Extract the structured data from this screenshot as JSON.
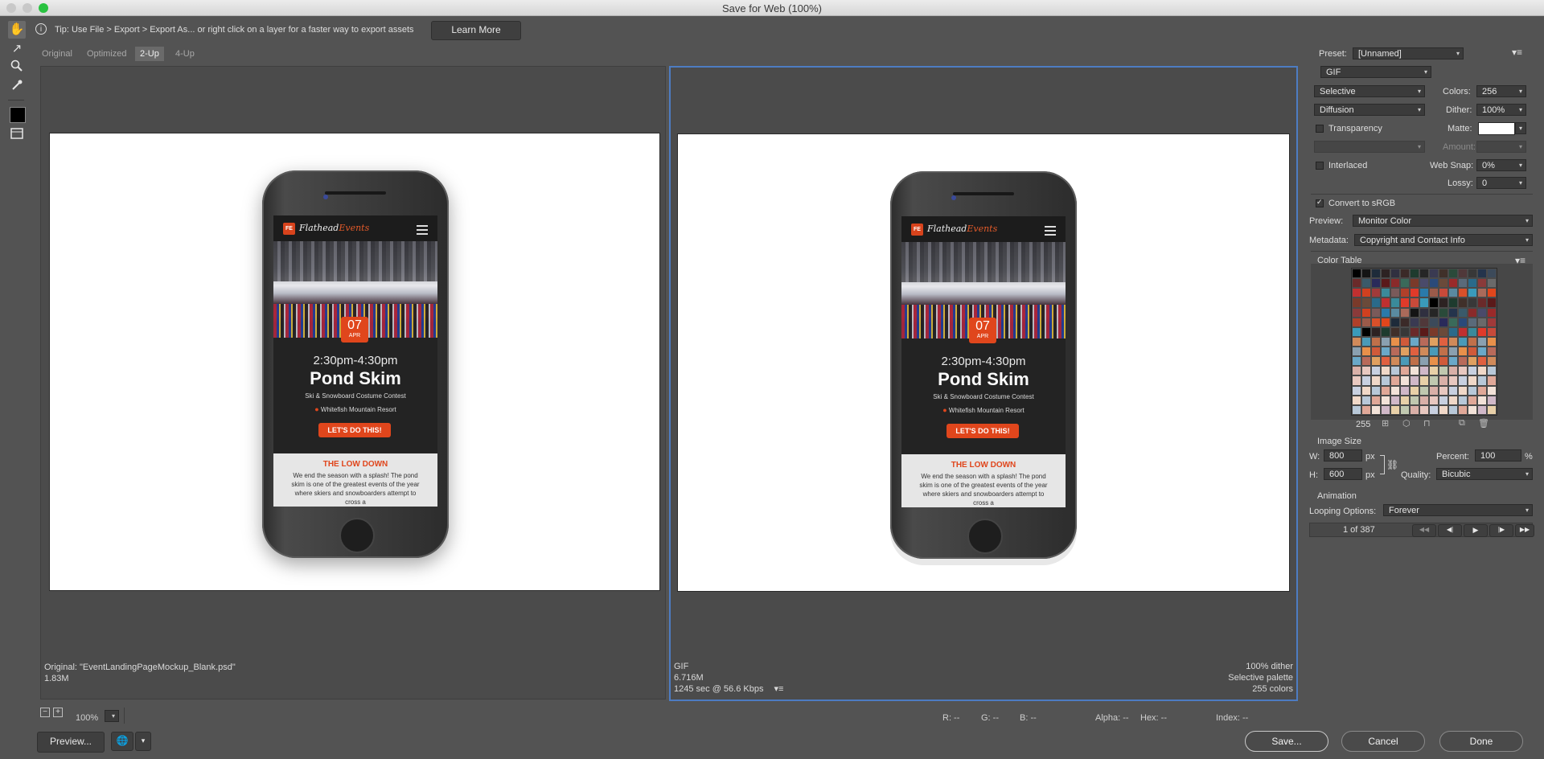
{
  "window": {
    "title": "Save for Web (100%)"
  },
  "tip": {
    "text": "Tip: Use File > Export > Export As...  or right click on a layer for a faster way to export assets",
    "learn_more": "Learn More"
  },
  "tabs": [
    "Original",
    "Optimized",
    "2-Up",
    "4-Up"
  ],
  "active_tab": "2-Up",
  "mockup": {
    "logo_badge": "FE",
    "logo_main": "Flathead",
    "logo_accent": "Events",
    "date_day": "07",
    "date_month": "APR",
    "time": "2:30pm-4:30pm",
    "title": "Pond Skim",
    "subtitle": "Ski & Snowboard Costume Contest",
    "location": "Whitefish Mountain Resort",
    "cta": "LET'S DO THIS!",
    "lowdown_heading": "THE LOW DOWN",
    "lowdown_text": "We end the season with a splash! The pond skim is one of the greatest events of the year where skiers and snowboarders attempt to cross a"
  },
  "left_info": {
    "line1": "Original: \"EventLandingPageMockup_Blank.psd\"",
    "line2": "1.83M"
  },
  "right_info": {
    "format": "GIF",
    "size": "6.716M",
    "time": "1245 sec @ 56.6 Kbps",
    "dither": "100% dither",
    "palette": "Selective palette",
    "colors": "255 colors"
  },
  "settings": {
    "preset_label": "Preset:",
    "preset_value": "[Unnamed]",
    "format": "GIF",
    "reduction": "Selective",
    "colors_label": "Colors:",
    "colors_value": "256",
    "dither_algo": "Diffusion",
    "dither_label": "Dither:",
    "dither_value": "100%",
    "transparency": "Transparency",
    "matte_label": "Matte:",
    "amount_label": "Amount:",
    "interlaced": "Interlaced",
    "websnap_label": "Web Snap:",
    "websnap_value": "0%",
    "lossy_label": "Lossy:",
    "lossy_value": "0",
    "convert_srgb": "Convert to sRGB",
    "preview_label": "Preview:",
    "preview_value": "Monitor Color",
    "metadata_label": "Metadata:",
    "metadata_value": "Copyright and Contact Info",
    "color_table_label": "Color Table",
    "color_count": "255",
    "image_size_label": "Image Size",
    "w_label": "W:",
    "w_value": "800",
    "h_label": "H:",
    "h_value": "600",
    "px": "px",
    "percent_label": "Percent:",
    "percent_value": "100",
    "percent_sign": "%",
    "quality_label": "Quality:",
    "quality_value": "Bicubic",
    "animation_label": "Animation",
    "looping_label": "Looping Options:",
    "looping_value": "Forever",
    "frame_counter": "1 of 387"
  },
  "statusbar": {
    "zoom": "100%",
    "r": "R: --",
    "g": "G: --",
    "b": "B: --",
    "alpha": "Alpha: --",
    "hex": "Hex: --",
    "index": "Index: --"
  },
  "buttons": {
    "preview": "Preview...",
    "save": "Save...",
    "cancel": "Cancel",
    "done": "Done"
  },
  "colors": {
    "accent": "#e0461c",
    "selection": "#4d7cc2",
    "panel": "#535353"
  }
}
